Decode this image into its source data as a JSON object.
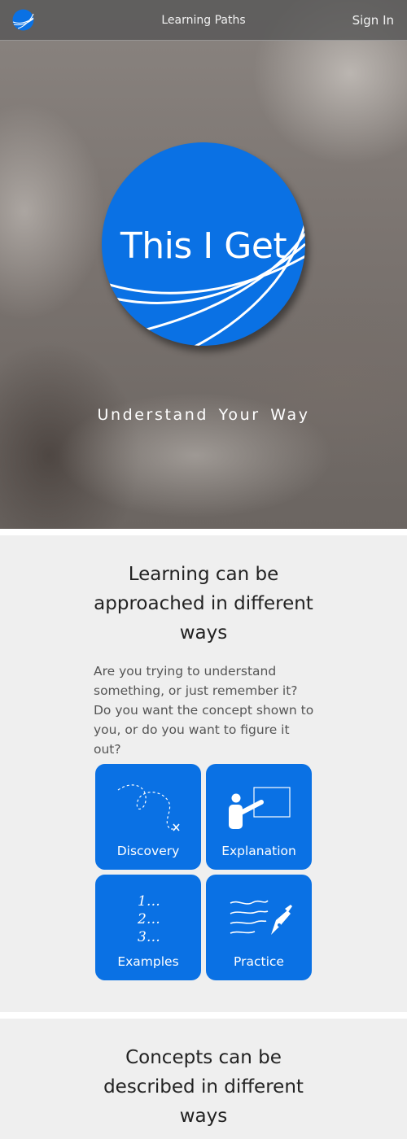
{
  "nav": {
    "center_link": "Learning Paths",
    "sign_in": "Sign In",
    "logo_icon": "globe-swoosh-icon"
  },
  "hero": {
    "logo_text": "This I Get",
    "tagline": "Understand Your Way"
  },
  "section1": {
    "title": "Learning can be approached in different ways",
    "body": "Are you trying to understand something, or just remember it? Do you want the concept shown to you, or do you want to figure it out?",
    "tiles": [
      {
        "label": "Discovery",
        "icon": "dotted-path-icon"
      },
      {
        "label": "Explanation",
        "icon": "presenter-board-icon"
      },
      {
        "label": "Examples",
        "icon": "numbered-list-icon",
        "list_lines": [
          "1…",
          "2…",
          "3…"
        ]
      },
      {
        "label": "Practice",
        "icon": "writing-pen-icon"
      }
    ]
  },
  "section2": {
    "title": "Concepts can be described in different ways"
  },
  "colors": {
    "brand_blue": "#0a71e4",
    "nav_bar": "#555555",
    "section_bg": "#efefef"
  }
}
